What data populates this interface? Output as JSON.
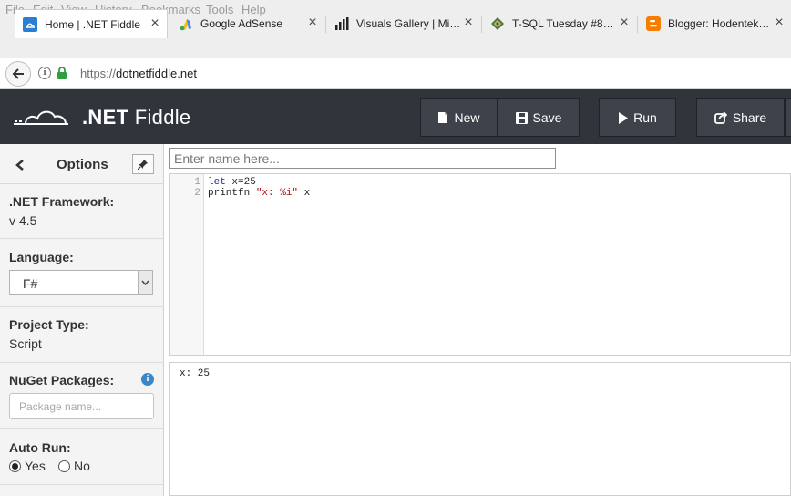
{
  "menu": [
    "File",
    "Edit",
    "View",
    "History",
    "Bookmarks",
    "Tools",
    "Help"
  ],
  "tabs": [
    {
      "label": "Home | .NET Fiddle",
      "icon": "dotnetfiddle-favicon"
    },
    {
      "label": "Google AdSense",
      "icon": "adsense-favicon"
    },
    {
      "label": "Visuals Gallery | Mi…",
      "icon": "bar-chart-favicon"
    },
    {
      "label": "T-SQL Tuesday #8…",
      "icon": "tsql-favicon"
    },
    {
      "label": "Blogger: Hodentek…",
      "icon": "blogger-favicon"
    }
  ],
  "address": {
    "protocol": "https://",
    "host": "dotnetfiddle.net"
  },
  "header": {
    "brand_prefix": ".NET",
    "brand_suffix": "Fiddle",
    "buttons": {
      "new": "New",
      "save": "Save",
      "run": "Run",
      "share": "Share"
    }
  },
  "sidebar": {
    "title": "Options",
    "framework": {
      "label": ".NET Framework:",
      "value": "v 4.5"
    },
    "language": {
      "label": "Language:",
      "value": "F#"
    },
    "project_type": {
      "label": "Project Type:",
      "value": "Script"
    },
    "nuget": {
      "label": "NuGet Packages:",
      "placeholder": "Package name..."
    },
    "auto_run": {
      "label": "Auto Run:",
      "yes": "Yes",
      "no": "No",
      "selected": "Yes"
    }
  },
  "main": {
    "name_placeholder": "Enter name here...",
    "line_numbers": [
      "1",
      "2"
    ],
    "code": {
      "line1_kw": "let",
      "line1_rest": " x=25",
      "line2_fn": "printfn ",
      "line2_str": "\"x: %i\"",
      "line2_rest": " x"
    },
    "output": "x: 25"
  },
  "colors": {
    "header_bg": "#30343b",
    "button_bg": "#3e434b",
    "keyword": "#1d2ca8",
    "string": "#a11111",
    "info_badge": "#3a87c7"
  }
}
